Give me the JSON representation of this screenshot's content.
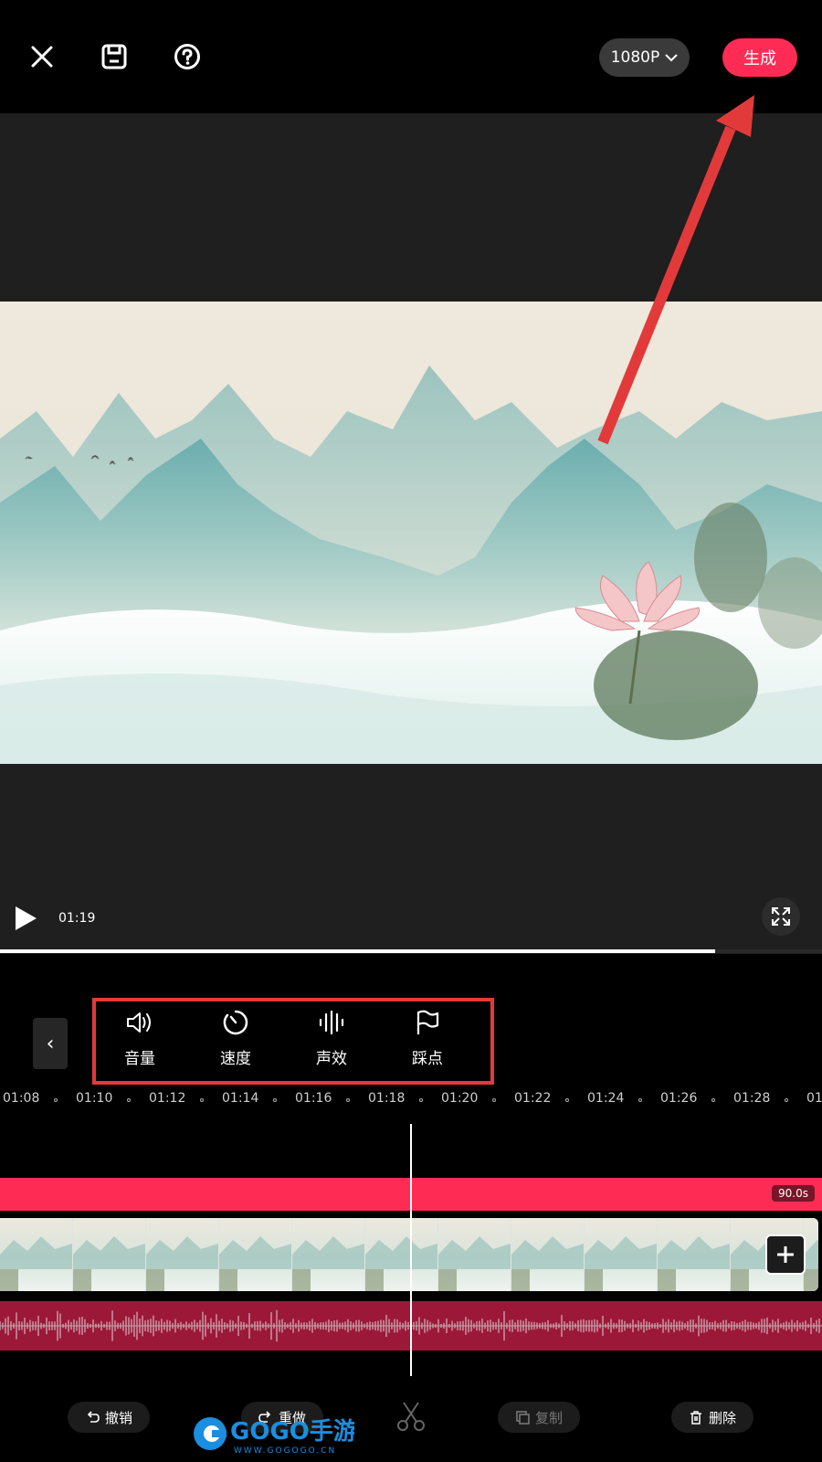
{
  "topbar": {
    "close_icon": "close-icon",
    "save_icon": "save-icon",
    "help_icon": "help-icon",
    "resolution_label": "1080P",
    "generate_label": "生成"
  },
  "player": {
    "current_time": "01:19",
    "progress": 0.87
  },
  "tools": {
    "items": [
      {
        "label": "音量",
        "icon": "volume-icon"
      },
      {
        "label": "速度",
        "icon": "speed-icon"
      },
      {
        "label": "声效",
        "icon": "sound-effect-icon"
      },
      {
        "label": "踩点",
        "icon": "beat-flag-icon"
      }
    ]
  },
  "ruler": {
    "ticks": [
      "01:08",
      "01:10",
      "01:12",
      "01:14",
      "01:16",
      "01:18",
      "01:20",
      "01:22",
      "01:24",
      "01:26",
      "01:28",
      "01"
    ]
  },
  "timeline": {
    "duration_badge": "90.0s"
  },
  "actions": {
    "undo": "撤销",
    "redo": "重做",
    "copy": "复制",
    "delete": "删除"
  },
  "watermark": {
    "brand": "GOGO手游网",
    "url": "WWW.GOGOGO.CN"
  },
  "colors": {
    "accent": "#fe2c55",
    "annotation": "#e23a3a",
    "audio_track": "#9c1838"
  }
}
